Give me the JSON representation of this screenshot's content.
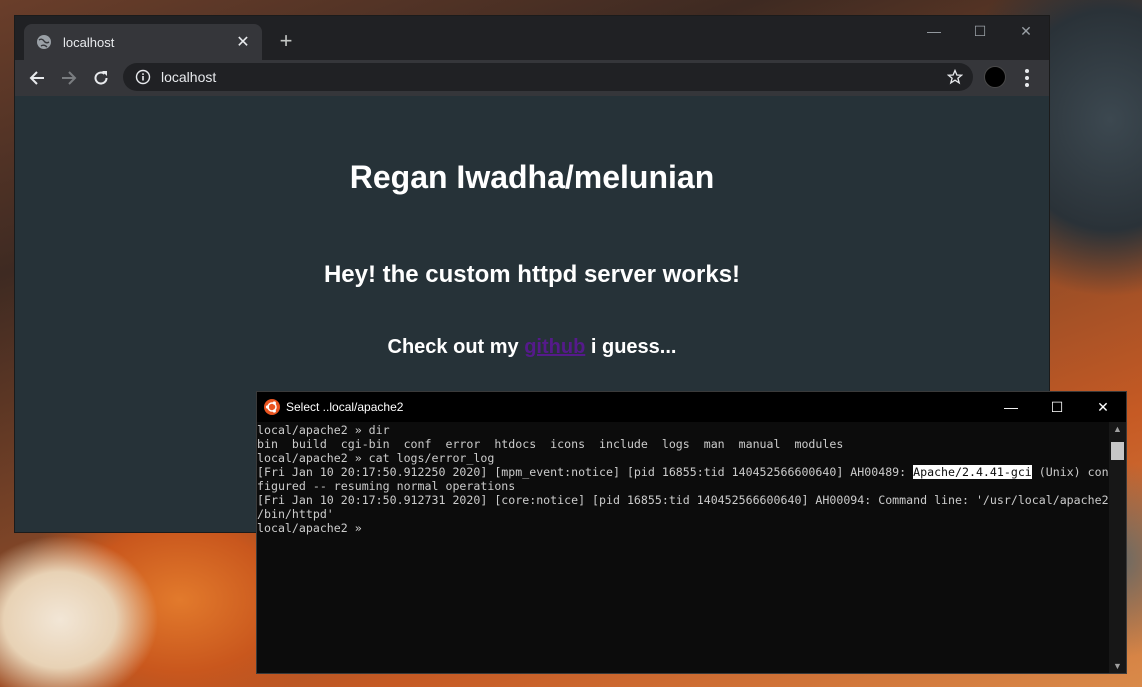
{
  "browser": {
    "tab": {
      "title": "localhost",
      "close": "✕"
    },
    "new_tab": "+",
    "window_controls": {
      "minimize": "—",
      "maximize": "☐",
      "close": "✕"
    },
    "address": "localhost",
    "icons": [
      "globe-icon",
      "back-icon",
      "forward-icon",
      "reload-icon",
      "info-icon",
      "star-icon",
      "profile-avatar",
      "menu-icon"
    ]
  },
  "page": {
    "heading": "Regan Iwadha/melunian",
    "subheading": "Hey! the custom httpd server works!",
    "note_before": "Check out my ",
    "note_link": "github",
    "note_after": " i guess...",
    "link_color": "#551a8b",
    "background": "#263238"
  },
  "terminal": {
    "title": "Select ..local/apache2",
    "window_controls": {
      "minimize": "—",
      "maximize": "☐",
      "close": "✕"
    },
    "lines": [
      "local/apache2 » dir",
      "bin  build  cgi-bin  conf  error  htdocs  icons  include  logs  man  manual  modules",
      "local/apache2 » cat logs/error_log"
    ],
    "log1_pre": "[Fri Jan 10 20:17:50.912250 2020] [mpm_event:notice] [pid 16855:tid 140452566600640] AH00489: ",
    "log1_highlight": "Apache/2.4.41-gci",
    "log1_post": " (Unix) con",
    "lines2": [
      "figured -- resuming normal operations",
      "[Fri Jan 10 20:17:50.912731 2020] [core:notice] [pid 16855:tid 140452566600640] AH00094: Command line: '/usr/local/apache2",
      "/bin/httpd'",
      "local/apache2 »"
    ]
  }
}
